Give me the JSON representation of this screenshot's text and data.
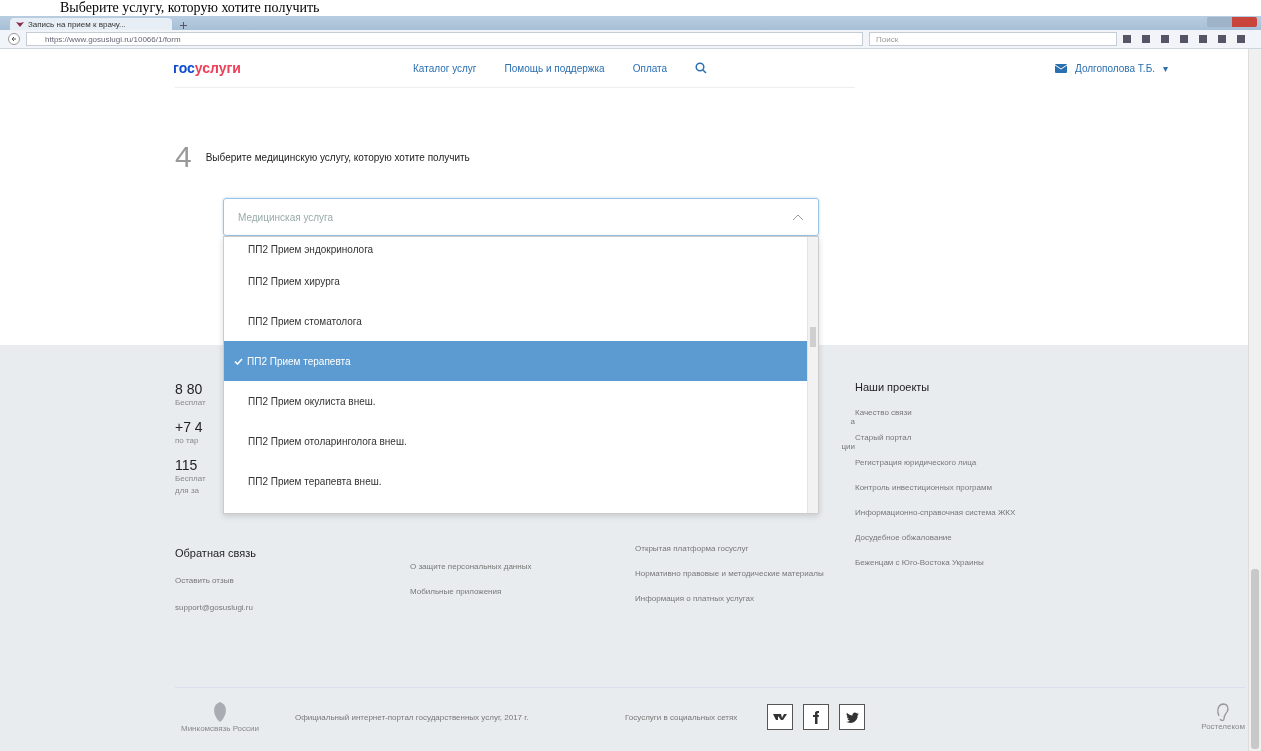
{
  "document_line": "Выберите услугу, которую хотите получить",
  "browser": {
    "tab_title": "Запись на прием к врачу...",
    "url": "https://www.gosuslugi.ru/10066/1/form",
    "search_placeholder": "Поиск"
  },
  "header": {
    "logo_gos": "гос",
    "logo_uslugi": "услуги",
    "nav": [
      "Каталог услуг",
      "Помощь и поддержка",
      "Оплата"
    ],
    "user": "Долгополова Т.Б.",
    "user_caret": "▾"
  },
  "step": {
    "number": "4",
    "title": "Выберите медицинскую услугу, которую хотите получить",
    "select_placeholder": "Медицинская услуга",
    "expanded": true,
    "options": [
      {
        "label": "ПП2 Прием эндокринолога",
        "selected": false
      },
      {
        "label": "ПП2 Прием хирурга",
        "selected": false
      },
      {
        "label": "ПП2 Прием стоматолога",
        "selected": false
      },
      {
        "label": "ПП2 Прием терапевта",
        "selected": true
      },
      {
        "label": "ПП2 Прием окулиста внеш.",
        "selected": false
      },
      {
        "label": "ПП2 Прием отоларинголога внеш.",
        "selected": false
      },
      {
        "label": "ПП2 Прием терапевта внеш.",
        "selected": false
      }
    ]
  },
  "footer": {
    "contacts": [
      {
        "phone": "8 80",
        "note": [
          "Бесплат"
        ]
      },
      {
        "phone": "+7 4",
        "note": [
          "по тар"
        ]
      },
      {
        "phone": "115",
        "note": [
          "Бесплат",
          "для за"
        ]
      }
    ],
    "feedback_title": "Обратная связь",
    "feedback_links": [
      "Оставить отзыв",
      "support@gosuslugi.ru"
    ],
    "column_2": [
      "О защите персональных данных",
      "Мобильные приложения"
    ],
    "column_3_fragments": [
      "а",
      "ции"
    ],
    "column_3": [
      "Открытая платформа госуслуг",
      "Нормативно правовые и методические материалы",
      "Информация о платных услугах"
    ],
    "projects_title": "Наши проекты",
    "projects": [
      "Качество связи",
      "Старый портал",
      "Регистрация юридического лица",
      "Контроль инвестиционных программ",
      "Информационно-справочная система ЖКХ",
      "Досудебное обжалование",
      "Беженцам с Юго-Востока Украины"
    ],
    "emblem_caption": "Минкомсвязь России",
    "copyright": "Официальный интернет-портал государственных услуг, 2017 г.",
    "social_title": "Госуслуги в социальных сетях",
    "rostelecom": "Ростелеком"
  }
}
